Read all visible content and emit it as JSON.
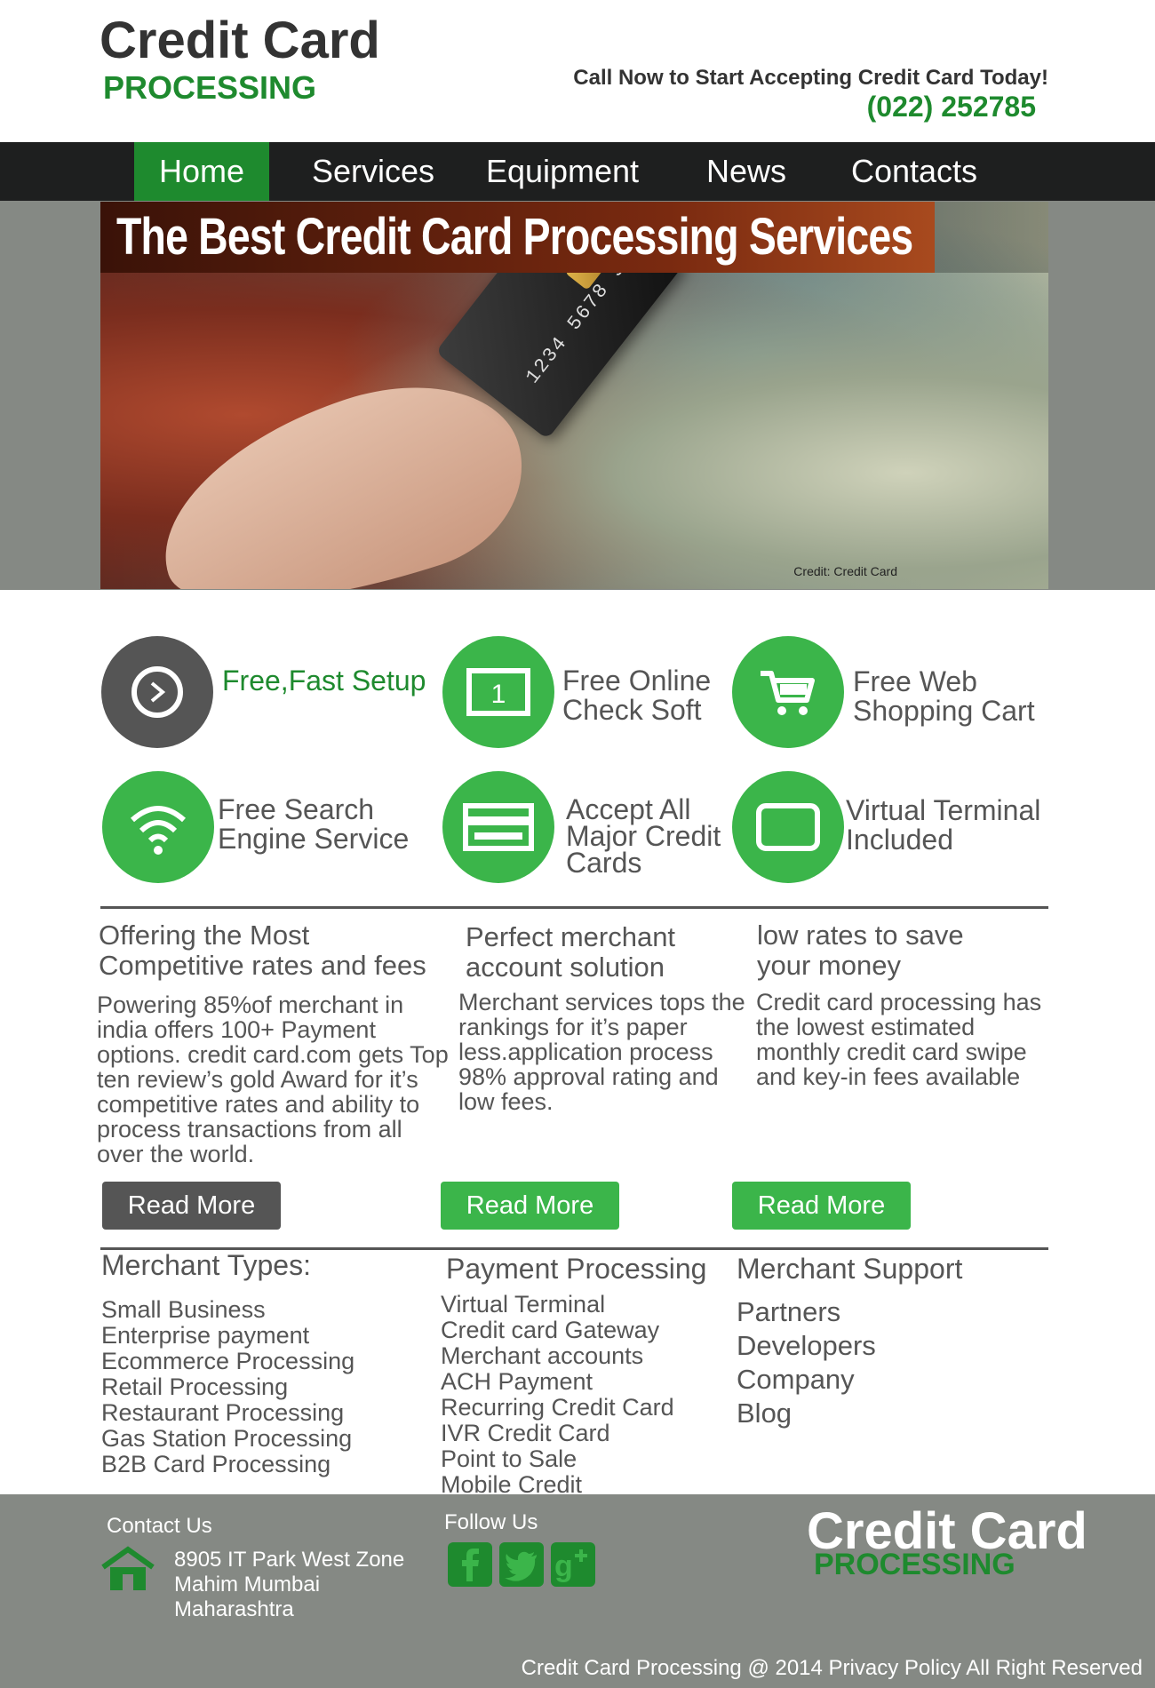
{
  "header": {
    "logo_line1": "Credit Card",
    "logo_line2": "PROCESSING",
    "call_text": "Call Now to Start Accepting Credit Card Today!",
    "phone": "(022) 252785"
  },
  "nav": {
    "items": [
      {
        "label": "Home"
      },
      {
        "label": "Services"
      },
      {
        "label": "Equipment"
      },
      {
        "label": "News"
      },
      {
        "label": "Contacts"
      }
    ]
  },
  "hero": {
    "title": "The Best Credit Card Processing Services",
    "credit": "Credit: Credit Card"
  },
  "features": [
    {
      "label": "Free,Fast Setup",
      "icon": "play-arrow-icon"
    },
    {
      "label": "Free Online Check Soft",
      "icon": "monitor-icon"
    },
    {
      "label": "Free Web Shopping Cart",
      "icon": "shopping-cart-icon"
    },
    {
      "label": "Free Search Engine Service",
      "icon": "wifi-icon"
    },
    {
      "label": "Accept All Major Credit Cards",
      "icon": "credit-card-icon"
    },
    {
      "label": "Virtual Terminal Included",
      "icon": "terminal-icon"
    }
  ],
  "columns": [
    {
      "title": "Offering the Most Competitive rates and fees",
      "text": "Powering 85%of merchant in india offers 100+ Payment options. credit card.com gets Top ten review’s gold Award for it’s competitive rates and ability to process transactions from all over the world.",
      "button": "Read More"
    },
    {
      "title": "Perfect merchant account solution",
      "text": "Merchant services tops the rankings for it’s paper less.application process 98% approval rating and low fees.",
      "button": "Read More"
    },
    {
      "title": "low rates to save your money",
      "text": "Credit card processing has the lowest estimated monthly credit card swipe and key-in fees available",
      "button": "Read More"
    }
  ],
  "links": {
    "merchant_types": {
      "title": "Merchant Types:",
      "items": [
        "Small Business",
        "Enterprise payment",
        "Ecommerce Processing",
        "Retail Processing",
        "Restaurant Processing",
        "Gas Station Processing",
        "B2B Card Processing"
      ]
    },
    "payment_processing": {
      "title": "Payment Processing",
      "items": [
        "Virtual Terminal",
        "Credit card Gateway",
        "Merchant accounts",
        "ACH Payment",
        "Recurring Credit Card",
        "IVR Credit Card",
        "Point to Sale",
        "Mobile Credit"
      ]
    },
    "merchant_support": {
      "title": "Merchant Support",
      "items": [
        "Partners",
        "Developers",
        "Company",
        "Blog"
      ]
    }
  },
  "footer": {
    "contact_title": "Contact Us",
    "address": [
      "8905 IT Park West Zone",
      "Mahim Mumbai",
      "Maharashtra"
    ],
    "follow_title": "Follow Us",
    "logo_line1": "Credit Card",
    "logo_line2": "PROCESSING",
    "copyright": "Credit Card Processing @ 2014 Privacy Policy All Right Reserved"
  },
  "colors": {
    "brand_green": "#1e8a2e",
    "accent_green": "#3bb54a",
    "dark_gray": "#555555",
    "nav_bg": "#1e1f1f"
  }
}
